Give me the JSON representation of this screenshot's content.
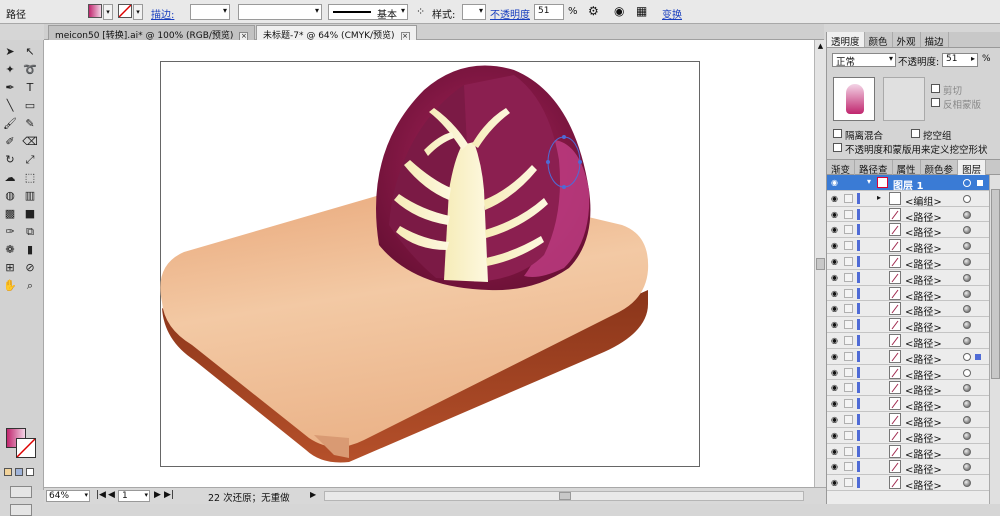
{
  "control_bar": {
    "object_type": "路径",
    "stroke_label": "描边:",
    "stroke_style": "基本",
    "style_label": "样式:",
    "opacity_label": "不透明度",
    "opacity_value": "51",
    "opacity_unit": "%",
    "transform_label": "变换"
  },
  "tabs": [
    {
      "label": "meicon50 [转换].ai* @ 100% (RGB/预览)"
    },
    {
      "label": "未标题-7* @ 64% (CMYK/预览)"
    }
  ],
  "status_bar": {
    "zoom": "64%",
    "artboard": "1",
    "status_text": "22 次还原；无重做"
  },
  "panel": {
    "top_tabs": [
      "透明度",
      "颜色",
      "外观",
      "描边"
    ],
    "blend_mode": "正常",
    "opacity_label": "不透明度:",
    "opacity_value": "51",
    "opacity_unit": "%",
    "clip_label": "剪切",
    "invert_mask_label": "反相蒙版",
    "isolate_blend_label": "隔离混合",
    "knockout_group_label": "挖空组",
    "opacity_mask_label": "不透明度和蒙版用来定义挖空形状",
    "layer_tabs": [
      "渐变",
      "路径查",
      "属性",
      "颜色参",
      "图层"
    ],
    "layer_name": "图层 1",
    "group_name": "<编组>",
    "rows": [
      "<路径>",
      "<路径>",
      "<路径>",
      "<路径>",
      "<路径>",
      "<路径>",
      "<路径>",
      "<路径>",
      "<路径>",
      "<路径>",
      "<路径>",
      "<路径>",
      "<路径>",
      "<路径>",
      "<路径>",
      "<路径>",
      "<路径>",
      "<路径>"
    ]
  },
  "colors": {
    "fill_gradient_start": "#c0266e",
    "fill_gradient_end": "#f3d4e6",
    "layer_accent": "#4f6bd6",
    "cabbage_purple": "#7a1440",
    "board_tan": "#f0b98a"
  }
}
